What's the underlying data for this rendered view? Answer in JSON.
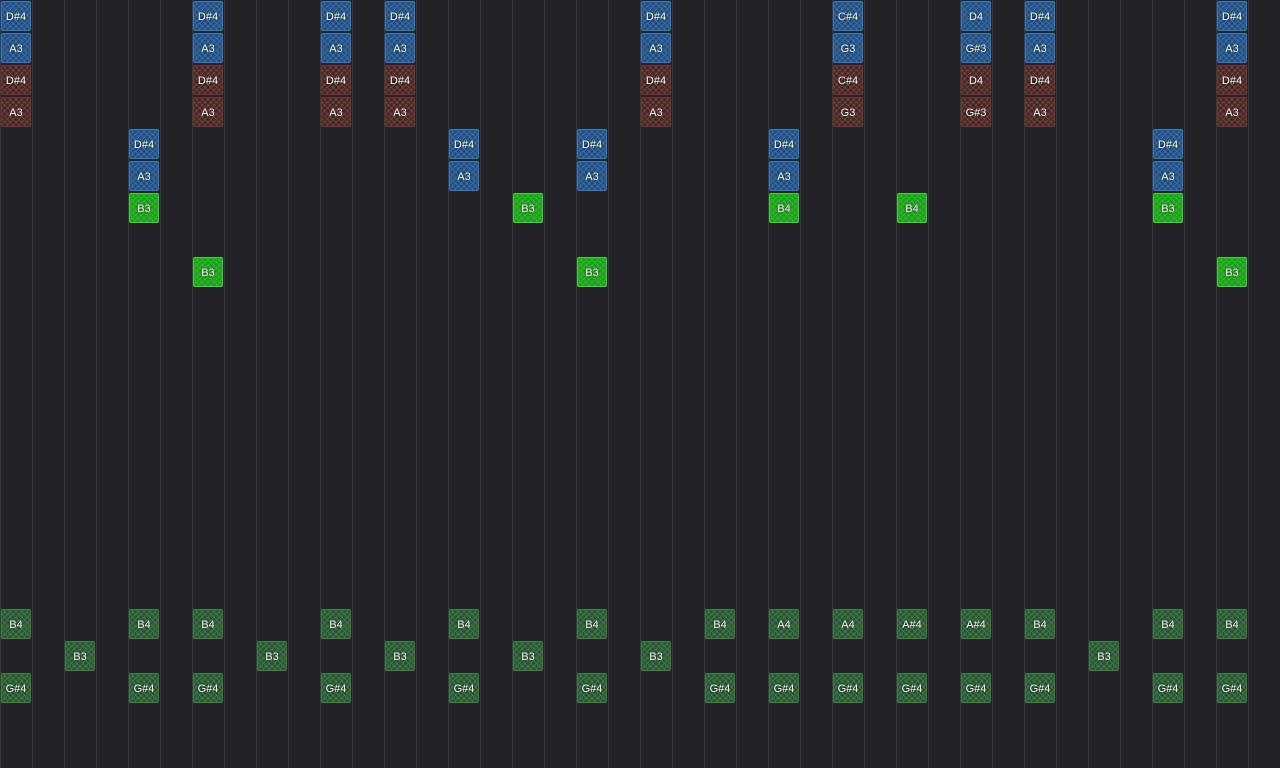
{
  "colors": {
    "background": "#232325",
    "grid_line": "#3a3a3c",
    "blue": "#1c4f86",
    "red": "#4a2220",
    "green": "#17a114",
    "dark_green": "#24582c"
  },
  "grid": {
    "columns": 40,
    "rows": 24
  },
  "notes": [
    {
      "label": "D#4",
      "col": 0,
      "row": 0,
      "type": "blue"
    },
    {
      "label": "A3",
      "col": 0,
      "row": 1,
      "type": "blue"
    },
    {
      "label": "D#4",
      "col": 0,
      "row": 2,
      "type": "red"
    },
    {
      "label": "A3",
      "col": 0,
      "row": 3,
      "type": "red"
    },
    {
      "label": "B4",
      "col": 0,
      "row": 19,
      "type": "dark-green"
    },
    {
      "label": "G#4",
      "col": 0,
      "row": 21,
      "type": "dark-green"
    },
    {
      "label": "B3",
      "col": 2,
      "row": 20,
      "type": "dark-green"
    },
    {
      "label": "D#4",
      "col": 4,
      "row": 4,
      "type": "blue"
    },
    {
      "label": "A3",
      "col": 4,
      "row": 5,
      "type": "blue"
    },
    {
      "label": "B3",
      "col": 4,
      "row": 6,
      "type": "green"
    },
    {
      "label": "B4",
      "col": 4,
      "row": 19,
      "type": "dark-green"
    },
    {
      "label": "G#4",
      "col": 4,
      "row": 21,
      "type": "dark-green"
    },
    {
      "label": "D#4",
      "col": 6,
      "row": 0,
      "type": "blue"
    },
    {
      "label": "A3",
      "col": 6,
      "row": 1,
      "type": "blue"
    },
    {
      "label": "D#4",
      "col": 6,
      "row": 2,
      "type": "red"
    },
    {
      "label": "A3",
      "col": 6,
      "row": 3,
      "type": "red"
    },
    {
      "label": "B3",
      "col": 6,
      "row": 8,
      "type": "green"
    },
    {
      "label": "B4",
      "col": 6,
      "row": 19,
      "type": "dark-green"
    },
    {
      "label": "G#4",
      "col": 6,
      "row": 21,
      "type": "dark-green"
    },
    {
      "label": "B3",
      "col": 8,
      "row": 20,
      "type": "dark-green"
    },
    {
      "label": "D#4",
      "col": 10,
      "row": 0,
      "type": "blue"
    },
    {
      "label": "A3",
      "col": 10,
      "row": 1,
      "type": "blue"
    },
    {
      "label": "D#4",
      "col": 10,
      "row": 2,
      "type": "red"
    },
    {
      "label": "A3",
      "col": 10,
      "row": 3,
      "type": "red"
    },
    {
      "label": "B4",
      "col": 10,
      "row": 19,
      "type": "dark-green"
    },
    {
      "label": "G#4",
      "col": 10,
      "row": 21,
      "type": "dark-green"
    },
    {
      "label": "D#4",
      "col": 12,
      "row": 0,
      "type": "blue"
    },
    {
      "label": "A3",
      "col": 12,
      "row": 1,
      "type": "blue"
    },
    {
      "label": "D#4",
      "col": 12,
      "row": 2,
      "type": "red"
    },
    {
      "label": "A3",
      "col": 12,
      "row": 3,
      "type": "red"
    },
    {
      "label": "B3",
      "col": 12,
      "row": 20,
      "type": "dark-green"
    },
    {
      "label": "D#4",
      "col": 14,
      "row": 4,
      "type": "blue"
    },
    {
      "label": "A3",
      "col": 14,
      "row": 5,
      "type": "blue"
    },
    {
      "label": "B4",
      "col": 14,
      "row": 19,
      "type": "dark-green"
    },
    {
      "label": "G#4",
      "col": 14,
      "row": 21,
      "type": "dark-green"
    },
    {
      "label": "B3",
      "col": 16,
      "row": 6,
      "type": "green"
    },
    {
      "label": "B3",
      "col": 16,
      "row": 20,
      "type": "dark-green"
    },
    {
      "label": "D#4",
      "col": 18,
      "row": 4,
      "type": "blue"
    },
    {
      "label": "A3",
      "col": 18,
      "row": 5,
      "type": "blue"
    },
    {
      "label": "B3",
      "col": 18,
      "row": 8,
      "type": "green"
    },
    {
      "label": "B4",
      "col": 18,
      "row": 19,
      "type": "dark-green"
    },
    {
      "label": "G#4",
      "col": 18,
      "row": 21,
      "type": "dark-green"
    },
    {
      "label": "D#4",
      "col": 20,
      "row": 0,
      "type": "blue"
    },
    {
      "label": "A3",
      "col": 20,
      "row": 1,
      "type": "blue"
    },
    {
      "label": "D#4",
      "col": 20,
      "row": 2,
      "type": "red"
    },
    {
      "label": "A3",
      "col": 20,
      "row": 3,
      "type": "red"
    },
    {
      "label": "B3",
      "col": 20,
      "row": 20,
      "type": "dark-green"
    },
    {
      "label": "B4",
      "col": 22,
      "row": 19,
      "type": "dark-green"
    },
    {
      "label": "G#4",
      "col": 22,
      "row": 21,
      "type": "dark-green"
    },
    {
      "label": "D#4",
      "col": 24,
      "row": 4,
      "type": "blue"
    },
    {
      "label": "A3",
      "col": 24,
      "row": 5,
      "type": "blue"
    },
    {
      "label": "B4",
      "col": 24,
      "row": 6,
      "type": "green"
    },
    {
      "label": "A4",
      "col": 24,
      "row": 19,
      "type": "dark-green"
    },
    {
      "label": "G#4",
      "col": 24,
      "row": 21,
      "type": "dark-green"
    },
    {
      "label": "C#4",
      "col": 26,
      "row": 0,
      "type": "blue"
    },
    {
      "label": "G3",
      "col": 26,
      "row": 1,
      "type": "blue"
    },
    {
      "label": "C#4",
      "col": 26,
      "row": 2,
      "type": "red"
    },
    {
      "label": "G3",
      "col": 26,
      "row": 3,
      "type": "red"
    },
    {
      "label": "A4",
      "col": 26,
      "row": 19,
      "type": "dark-green"
    },
    {
      "label": "G#4",
      "col": 26,
      "row": 21,
      "type": "dark-green"
    },
    {
      "label": "B4",
      "col": 28,
      "row": 6,
      "type": "green"
    },
    {
      "label": "A#4",
      "col": 28,
      "row": 19,
      "type": "dark-green"
    },
    {
      "label": "G#4",
      "col": 28,
      "row": 21,
      "type": "dark-green"
    },
    {
      "label": "D4",
      "col": 30,
      "row": 0,
      "type": "blue"
    },
    {
      "label": "G#3",
      "col": 30,
      "row": 1,
      "type": "blue"
    },
    {
      "label": "D4",
      "col": 30,
      "row": 2,
      "type": "red"
    },
    {
      "label": "G#3",
      "col": 30,
      "row": 3,
      "type": "red"
    },
    {
      "label": "A#4",
      "col": 30,
      "row": 19,
      "type": "dark-green"
    },
    {
      "label": "G#4",
      "col": 30,
      "row": 21,
      "type": "dark-green"
    },
    {
      "label": "D#4",
      "col": 32,
      "row": 0,
      "type": "blue"
    },
    {
      "label": "A3",
      "col": 32,
      "row": 1,
      "type": "blue"
    },
    {
      "label": "D#4",
      "col": 32,
      "row": 2,
      "type": "red"
    },
    {
      "label": "A3",
      "col": 32,
      "row": 3,
      "type": "red"
    },
    {
      "label": "B4",
      "col": 32,
      "row": 19,
      "type": "dark-green"
    },
    {
      "label": "G#4",
      "col": 32,
      "row": 21,
      "type": "dark-green"
    },
    {
      "label": "B3",
      "col": 34,
      "row": 20,
      "type": "dark-green"
    },
    {
      "label": "D#4",
      "col": 36,
      "row": 4,
      "type": "blue"
    },
    {
      "label": "A3",
      "col": 36,
      "row": 5,
      "type": "blue"
    },
    {
      "label": "B3",
      "col": 36,
      "row": 6,
      "type": "green"
    },
    {
      "label": "B4",
      "col": 36,
      "row": 19,
      "type": "dark-green"
    },
    {
      "label": "G#4",
      "col": 36,
      "row": 21,
      "type": "dark-green"
    },
    {
      "label": "D#4",
      "col": 38,
      "row": 0,
      "type": "blue"
    },
    {
      "label": "A3",
      "col": 38,
      "row": 1,
      "type": "blue"
    },
    {
      "label": "D#4",
      "col": 38,
      "row": 2,
      "type": "red"
    },
    {
      "label": "A3",
      "col": 38,
      "row": 3,
      "type": "red"
    },
    {
      "label": "B3",
      "col": 38,
      "row": 8,
      "type": "green"
    },
    {
      "label": "B4",
      "col": 38,
      "row": 19,
      "type": "dark-green"
    },
    {
      "label": "G#4",
      "col": 38,
      "row": 21,
      "type": "dark-green"
    }
  ]
}
